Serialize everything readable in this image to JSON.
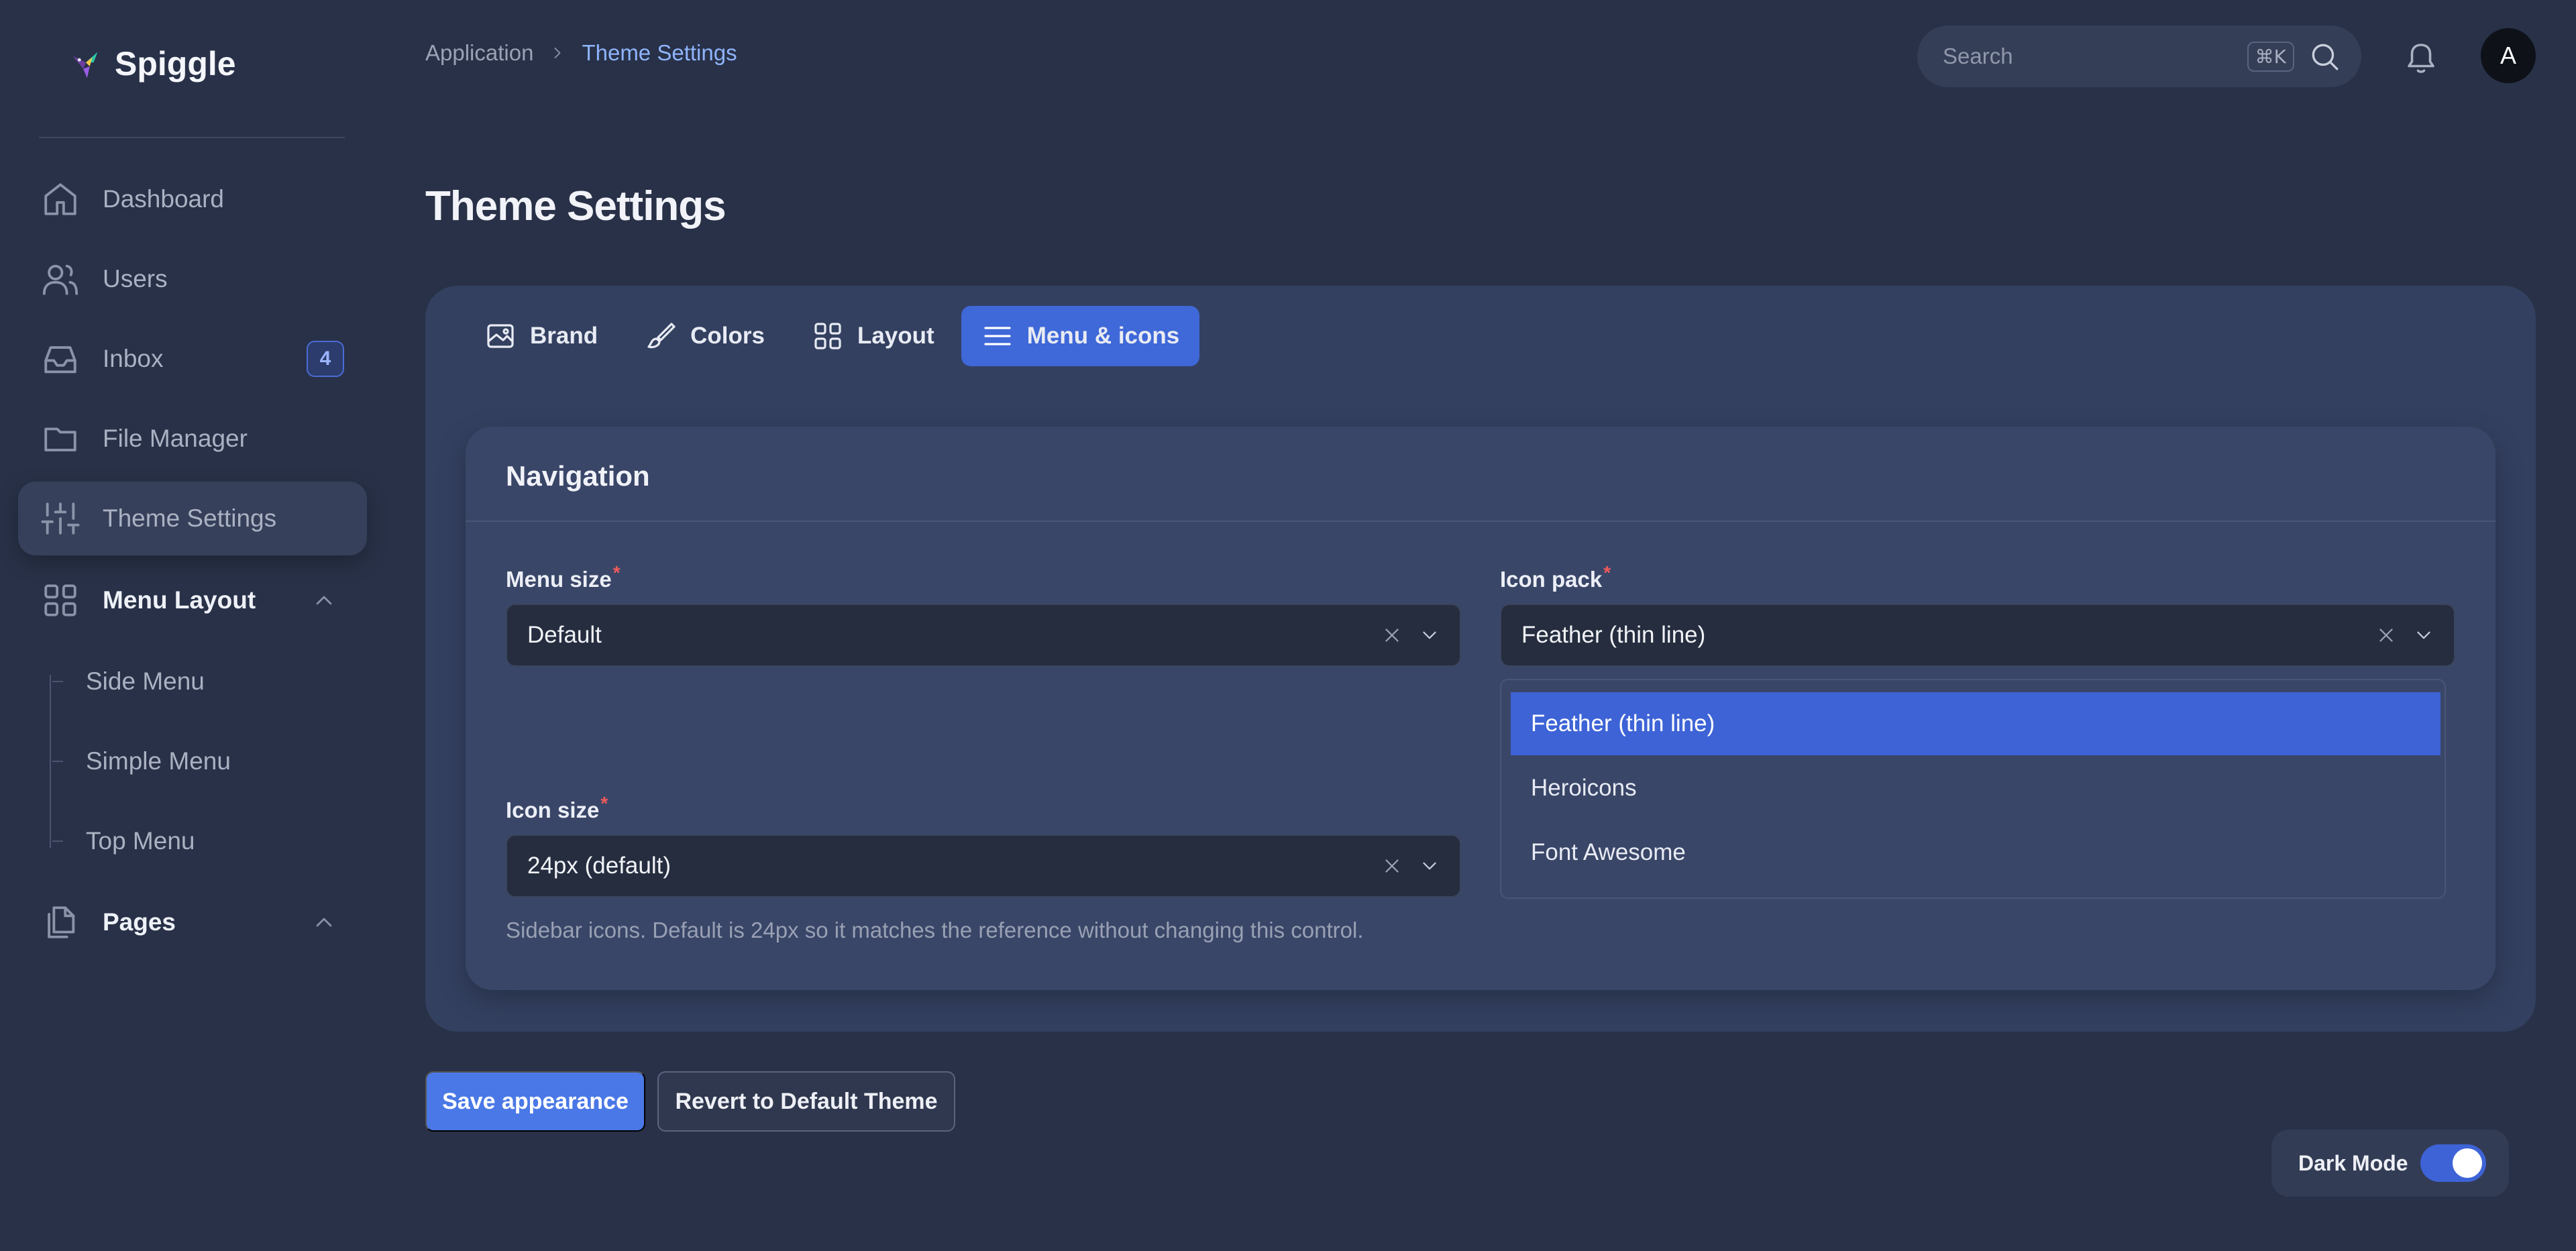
{
  "brand": {
    "name": "Spiggle"
  },
  "sidebar": {
    "items": [
      {
        "label": "Dashboard",
        "icon": "home-icon"
      },
      {
        "label": "Users",
        "icon": "users-icon"
      },
      {
        "label": "Inbox",
        "icon": "inbox-icon",
        "badge": "4"
      },
      {
        "label": "File Manager",
        "icon": "folder-icon"
      },
      {
        "label": "Theme Settings",
        "icon": "sliders-icon",
        "active": true
      }
    ],
    "menu_layout": {
      "label": "Menu Layout",
      "icon": "grid-icon",
      "expanded": true,
      "children": [
        "Side Menu",
        "Simple Menu",
        "Top Menu"
      ]
    },
    "pages": {
      "label": "Pages",
      "icon": "files-icon",
      "expanded": true
    }
  },
  "header": {
    "breadcrumb": {
      "root": "Application",
      "current": "Theme Settings"
    },
    "search": {
      "placeholder": "Search",
      "shortcut": "⌘K"
    },
    "avatar_initial": "A"
  },
  "page_title": "Theme Settings",
  "tabs": [
    {
      "label": "Brand",
      "icon": "image-icon"
    },
    {
      "label": "Colors",
      "icon": "brush-icon"
    },
    {
      "label": "Layout",
      "icon": "layout-grid-icon"
    },
    {
      "label": "Menu & icons",
      "icon": "menu-lines-icon",
      "active": true
    }
  ],
  "navigation_card": {
    "title": "Navigation",
    "menu_size": {
      "label": "Menu size",
      "value": "Default"
    },
    "icon_pack": {
      "label": "Icon pack",
      "value": "Feather (thin line)",
      "options": [
        "Feather (thin line)",
        "Heroicons",
        "Font Awesome"
      ],
      "selected_index": 0,
      "open": true
    },
    "icon_size": {
      "label": "Icon size",
      "value": "24px (default)"
    },
    "helper_text": "Sidebar icons. Default is 24px so it matches the reference without changing this control."
  },
  "actions": {
    "save_label": "Save appearance",
    "revert_label": "Revert to Default Theme"
  },
  "dark_mode": {
    "label": "Dark Mode",
    "on": true
  },
  "colors": {
    "background": "#283147",
    "accent": "#3d63d6",
    "required": "#ef5a5a"
  }
}
